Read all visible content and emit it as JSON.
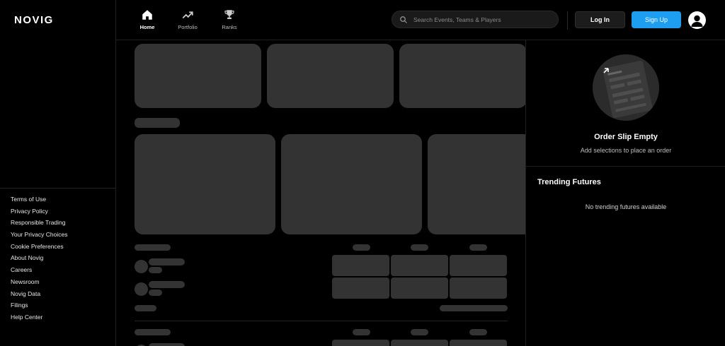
{
  "brand": {
    "logo": "NOVIG"
  },
  "nav": {
    "items": [
      {
        "label": "Home",
        "icon": "home-icon",
        "active": true
      },
      {
        "label": "Portfolio",
        "icon": "trending-up-icon",
        "active": false
      },
      {
        "label": "Ranks",
        "icon": "trophy-icon",
        "active": false
      }
    ]
  },
  "search": {
    "placeholder": "Search Events, Teams & Players",
    "value": ""
  },
  "auth": {
    "login_label": "Log In",
    "signup_label": "Sign Up"
  },
  "sidebar": {
    "links": [
      "Terms of Use",
      "Privacy Policy",
      "Responsible Trading",
      "Your Privacy Choices",
      "Cookie Preferences",
      "About Novig",
      "Careers",
      "Newsroom",
      "Novig Data",
      "Filings",
      "Help Center"
    ]
  },
  "order_slip": {
    "title": "Order Slip Empty",
    "subtitle": "Add selections to place an order"
  },
  "trending": {
    "title": "Trending Futures",
    "empty_text": "No trending futures available"
  },
  "colors": {
    "background": "#000000",
    "skeleton": "#333333",
    "accent": "#1e9ef0"
  }
}
